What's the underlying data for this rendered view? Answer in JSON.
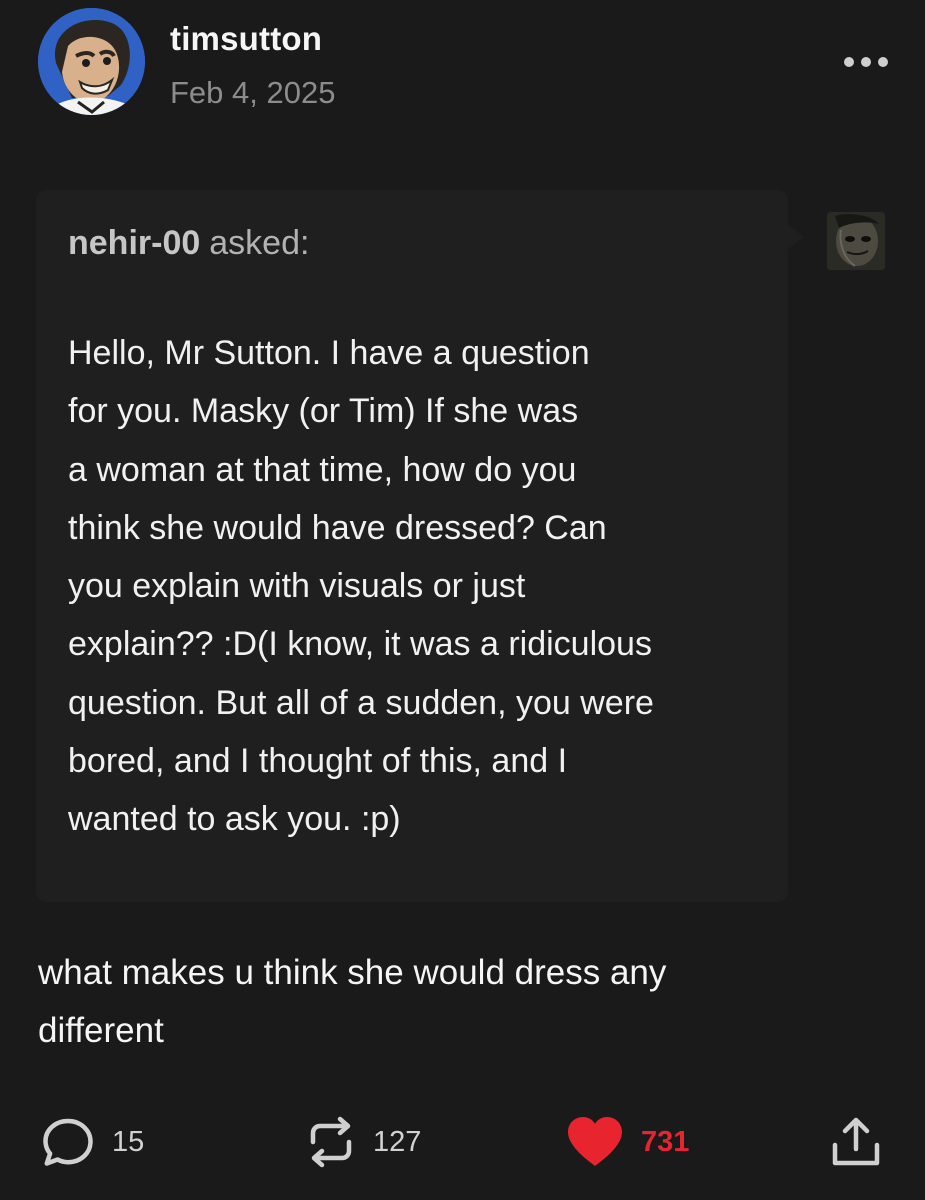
{
  "post": {
    "author": "timsutton",
    "date": "Feb 4, 2025"
  },
  "ask": {
    "asker": "nehir-00",
    "asked_suffix": "asked:",
    "question": "Hello, Mr Sutton. I have a question\nfor you. Masky (or Tim)  If she was\na woman at that time, how do you\nthink she would have dressed? Can\nyou explain with visuals or  just\nexplain?? :D(I know, it was a ridiculous\nquestion. But all of a sudden, you were\nbored, and I thought of this, and I\nwanted to ask you. :p)"
  },
  "answer": {
    "text": "what makes u think she would dress any\ndifferent"
  },
  "actions": {
    "replies_count": "15",
    "reblogs_count": "127",
    "likes_count": "731"
  },
  "icons": {
    "more": "more-options-icon",
    "reply": "reply-icon",
    "reblog": "reblog-icon",
    "like": "heart-icon",
    "share": "share-icon"
  },
  "colors": {
    "background": "#1a1a1a",
    "ask_box": "#1f1f1f",
    "like": "#e8242f",
    "muted_text": "#8c8c8c"
  }
}
